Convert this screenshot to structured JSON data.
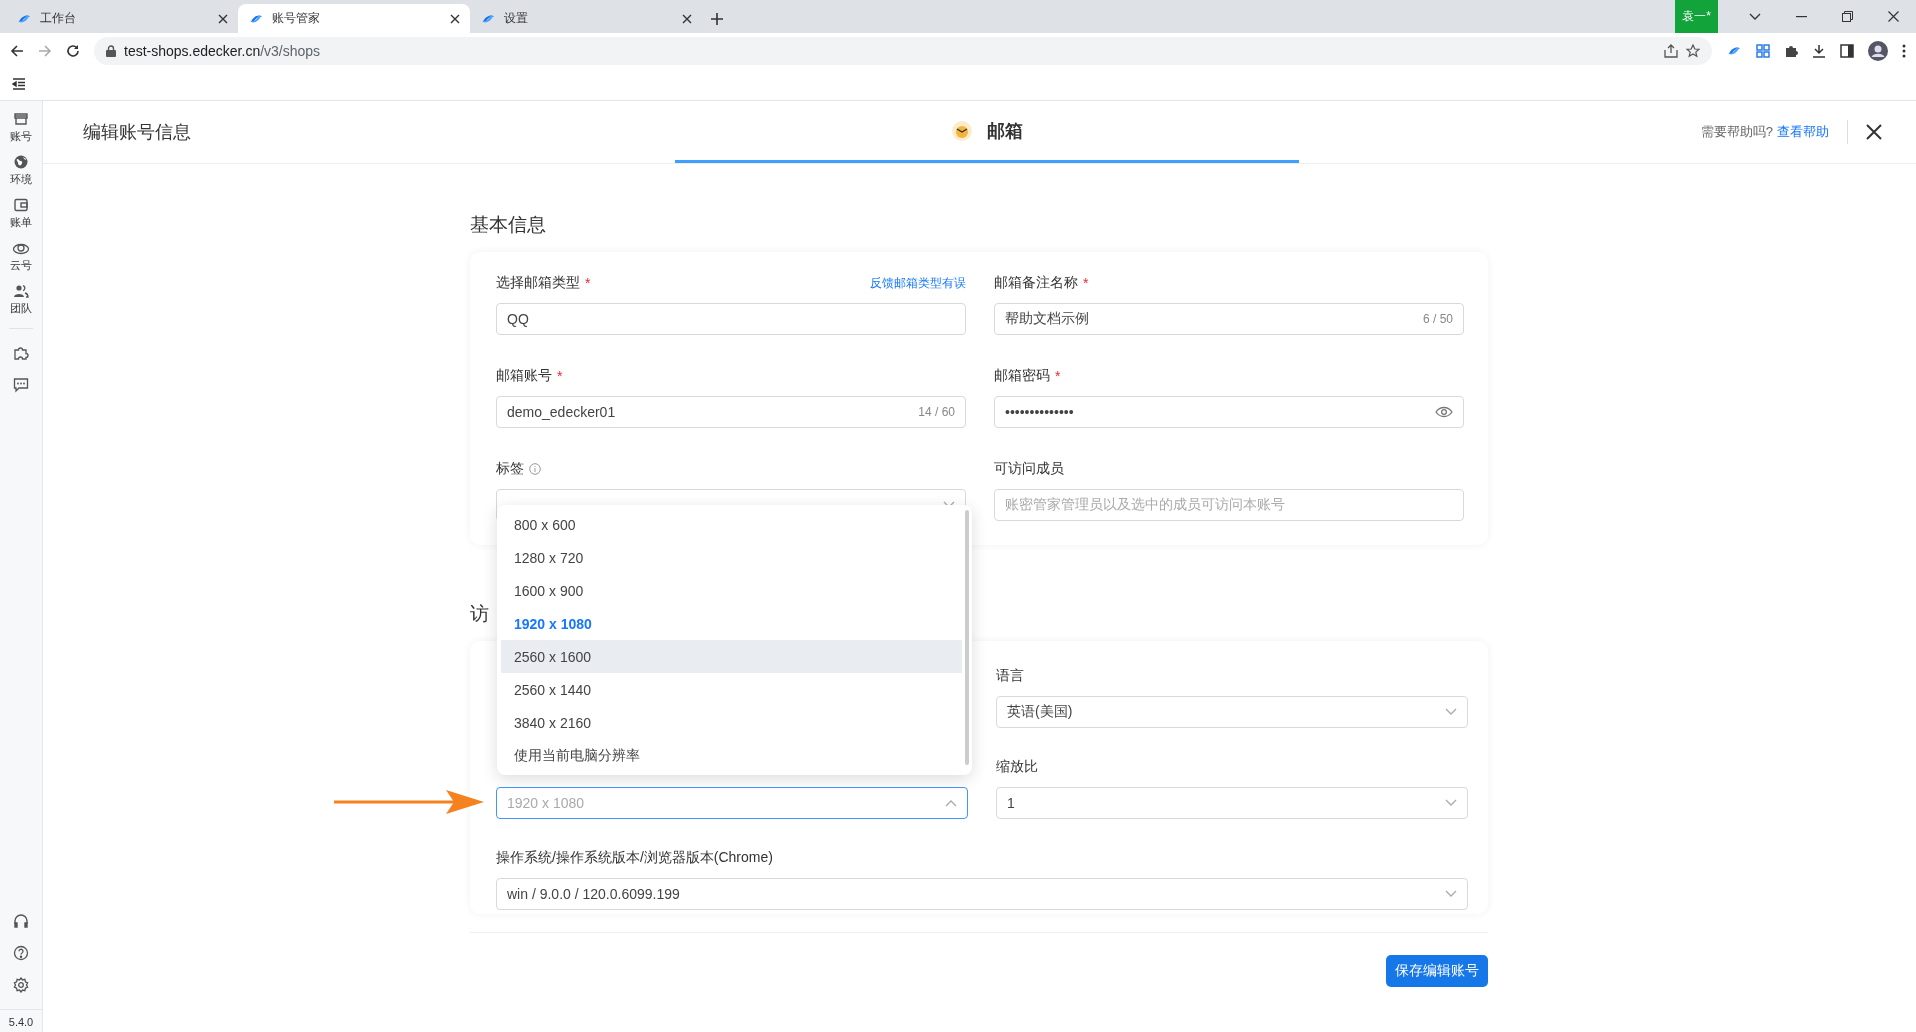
{
  "browser": {
    "tabs": [
      {
        "title": "工作台",
        "selected": false
      },
      {
        "title": "账号管家",
        "selected": true
      },
      {
        "title": "设置",
        "selected": false
      }
    ],
    "url_host": "test-shops.edecker.cn",
    "url_path": "/v3/shops",
    "profile_badge": "袁一*"
  },
  "sidebar": {
    "items": [
      {
        "label": "账号"
      },
      {
        "label": "环境"
      },
      {
        "label": "账单"
      },
      {
        "label": "云号"
      },
      {
        "label": "团队"
      }
    ],
    "version": "5.4.0"
  },
  "header": {
    "title": "编辑账号信息",
    "tab_label": "邮箱",
    "help_text": "需要帮助吗?",
    "help_link": "查看帮助"
  },
  "sections": [
    {
      "title": "基本信息",
      "fields": [
        {
          "kind": "input",
          "label": "选择邮箱类型",
          "required_mark": "*",
          "link": "反馈邮箱类型有误",
          "value": "QQ"
        },
        {
          "kind": "input",
          "label": "邮箱备注名称",
          "required_mark": "*",
          "value": "帮助文档示例",
          "counter": "6 / 50"
        },
        {
          "kind": "input",
          "label": "邮箱账号",
          "required_mark": "*",
          "value": "demo_edecker01",
          "counter": "14 / 60"
        },
        {
          "kind": "password",
          "label": "邮箱密码",
          "required_mark": "*",
          "value": "••••••••••••••"
        },
        {
          "kind": "select",
          "label": "标签",
          "info": true
        },
        {
          "kind": "input",
          "label": "可访问成员",
          "placeholder": "账密管家管理员以及选中的成员可访问本账号"
        }
      ]
    },
    {
      "title": "访",
      "fields": [
        {
          "kind": "select",
          "label": "语言",
          "value": "英语(美国)"
        },
        {
          "kind": "select",
          "value": "1920 x 1080",
          "open": true,
          "options": [
            {
              "label": "800 x 600",
              "selected": false,
              "hovered": false
            },
            {
              "label": "1280 x 720",
              "selected": false,
              "hovered": false
            },
            {
              "label": "1600 x 900",
              "selected": false,
              "hovered": false
            },
            {
              "label": "1920 x 1080",
              "selected": true,
              "hovered": false
            },
            {
              "label": "2560 x 1600",
              "selected": false,
              "hovered": true
            },
            {
              "label": "2560 x 1440",
              "selected": false,
              "hovered": false
            },
            {
              "label": "3840 x 2160",
              "selected": false,
              "hovered": false
            },
            {
              "label": "使用当前电脑分辨率",
              "selected": false,
              "hovered": false
            }
          ]
        },
        {
          "kind": "select",
          "label": "缩放比",
          "value": "1"
        },
        {
          "kind": "select",
          "wide": true,
          "label": "操作系统/操作系统版本/浏览器版本(Chrome)",
          "value": "win / 9.0.0 / 120.0.6099.199"
        }
      ]
    }
  ],
  "save_button": "保存编辑账号"
}
